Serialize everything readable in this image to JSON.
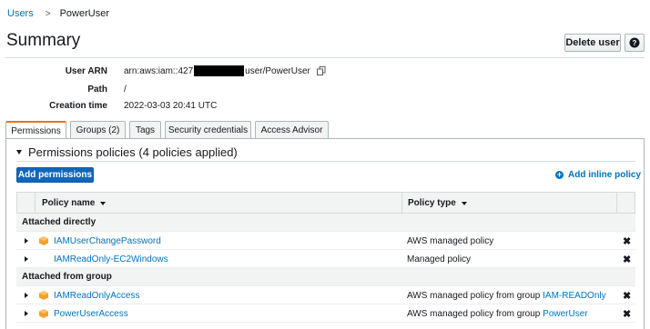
{
  "breadcrumb": {
    "parent": "Users",
    "separator": ">",
    "current": "PowerUser"
  },
  "page": {
    "title": "Summary"
  },
  "actions": {
    "delete_label": "Delete user",
    "help_icon": "help-icon"
  },
  "summary": {
    "fields": [
      {
        "label": "User ARN",
        "value_prefix": "arn:aws:iam::427",
        "value_suffix": "user/PowerUser",
        "redacted": true
      },
      {
        "label": "Path",
        "value": "/"
      },
      {
        "label": "Creation time",
        "value": "2022-03-03 20:41 UTC"
      }
    ]
  },
  "tabs": [
    {
      "label": "Permissions",
      "active": true
    },
    {
      "label": "Groups (2)"
    },
    {
      "label": "Tags"
    },
    {
      "label": "Security credentials"
    },
    {
      "label": "Access Advisor"
    }
  ],
  "permissions": {
    "section_title": "Permissions policies (4 policies applied)",
    "add_button": "Add permissions",
    "inline_link": "Add inline policy",
    "columns": {
      "name": "Policy name",
      "type": "Policy type"
    },
    "groups": [
      {
        "label": "Attached directly",
        "rows": [
          {
            "name": "IAMUserChangePassword",
            "type": "AWS managed policy",
            "type_link": "",
            "aws_icon": true
          },
          {
            "name": "IAMReadOnly-EC2Windows",
            "type": "Managed policy",
            "type_link": "",
            "aws_icon": false
          }
        ]
      },
      {
        "label": "Attached from group",
        "rows": [
          {
            "name": "IAMReadOnlyAccess",
            "type": "AWS managed policy from group",
            "type_link": "IAM-READOnly",
            "aws_icon": true
          },
          {
            "name": "PowerUserAccess",
            "type": "AWS managed policy from group",
            "type_link": "PowerUser",
            "aws_icon": true
          }
        ]
      }
    ]
  },
  "colors": {
    "link": "#0073bb",
    "primary": "#1166bb",
    "tab_accent": "#ec7211",
    "aws_icon": "#f7a02b"
  }
}
